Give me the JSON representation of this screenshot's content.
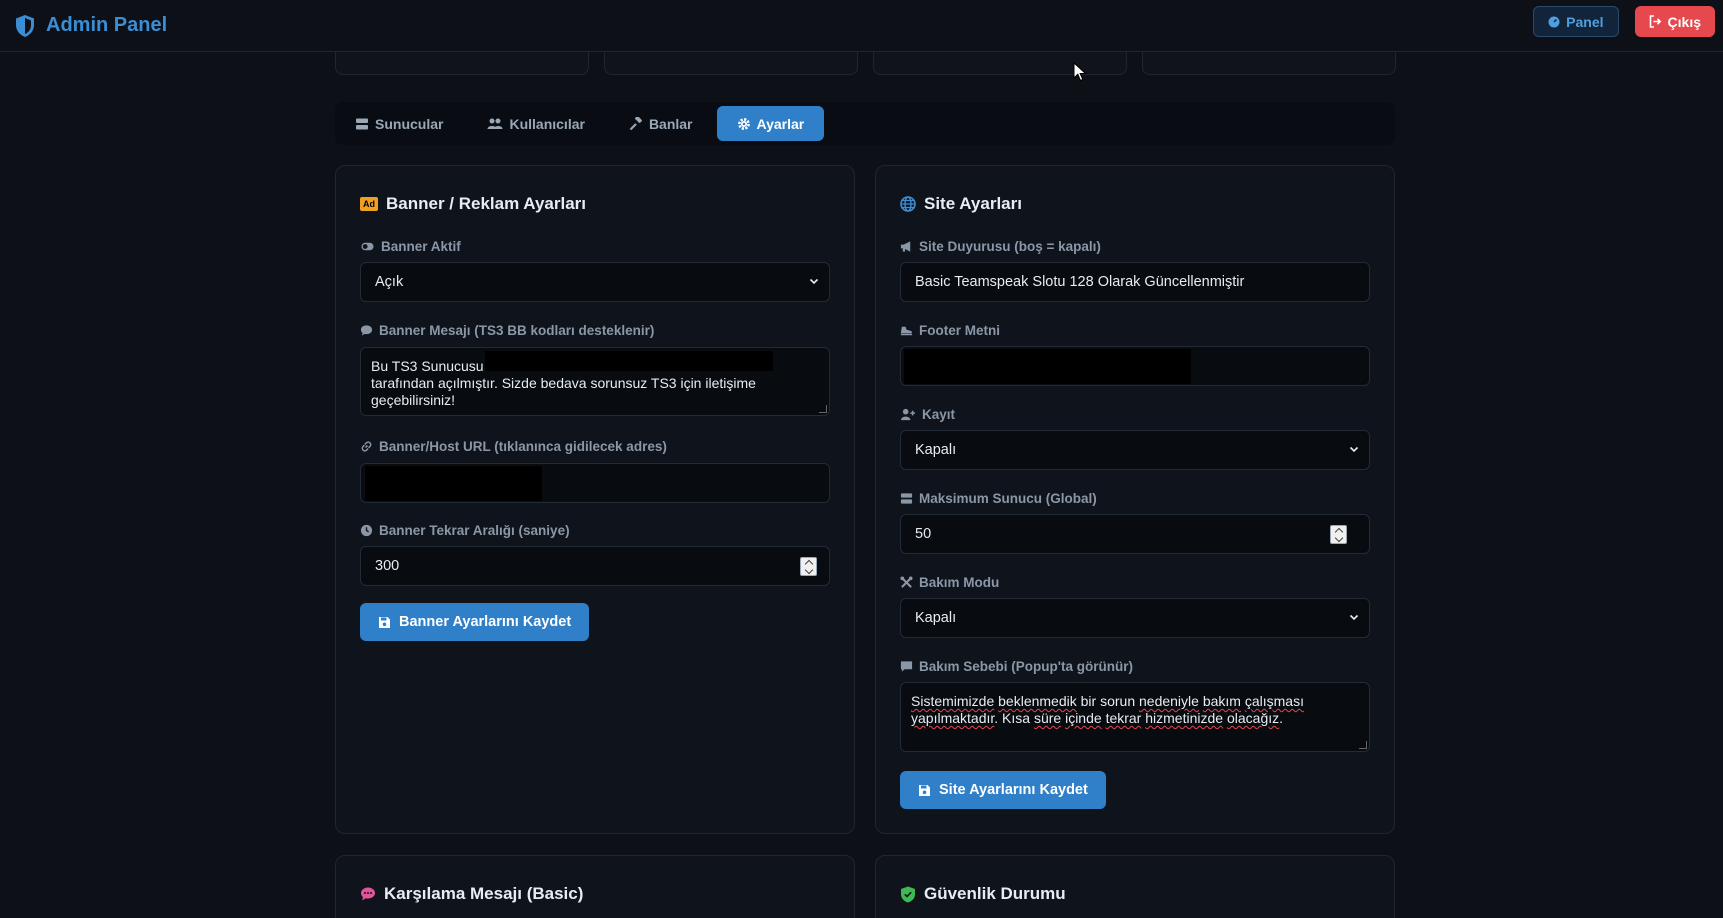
{
  "header": {
    "title": "Admin Panel",
    "panel_label": "Panel",
    "exit_label": "Çıkış"
  },
  "tabs": [
    {
      "label": "Sunucular",
      "icon": "server-icon",
      "active": false
    },
    {
      "label": "Kullanıcılar",
      "icon": "users-icon",
      "active": false
    },
    {
      "label": "Banlar",
      "icon": "gavel-icon",
      "active": false
    },
    {
      "label": "Ayarlar",
      "icon": "gear-icon",
      "active": true
    }
  ],
  "banner": {
    "title": "Banner / Reklam Ayarları",
    "badge": "Ad",
    "active_label": "Banner Aktif",
    "active_value": "Açık",
    "message_label": "Banner Mesajı (TS3 BB kodları desteklenir)",
    "message_line1": "Bu TS3 Sunucusu",
    "message_line2": "tarafından açılmıştır. Sizde bedava sorunsuz TS3 için iletişime",
    "message_line3": "geçebilirsiniz!",
    "url_label": "Banner/Host URL (tıklanınca gidilecek adres)",
    "interval_label": "Banner Tekrar Aralığı (saniye)",
    "interval_value": "300",
    "save_label": "Banner Ayarlarını Kaydet"
  },
  "site": {
    "title": "Site Ayarları",
    "announcement_label": "Site Duyurusu (boş = kapalı)",
    "announcement_value": "Basic Teamspeak Slotu 128 Olarak Güncellenmiştir",
    "footer_label": "Footer Metni",
    "register_label": "Kayıt",
    "register_value": "Kapalı",
    "max_server_label": "Maksimum Sunucu (Global)",
    "max_server_value": "50",
    "maintenance_label": "Bakım Modu",
    "maintenance_value": "Kapalı",
    "reason_label": "Bakım Sebebi (Popup'ta görünür)",
    "reason_w1": "Sistemimizde",
    "reason_w2": "beklenmedik",
    "reason_w3": "bir sorun",
    "reason_w4": "nedeniyle",
    "reason_w5": "bakım",
    "reason_w6": "çalışması",
    "reason_w7": "yapılmaktadır",
    "reason_w8": ". Kısa",
    "reason_w9": "süre",
    "reason_w10": "içinde",
    "reason_w11": "tekrar",
    "reason_w12": "hizmetinizde",
    "reason_w13": "olacağız",
    "reason_w14": ".",
    "save_label": "Site Ayarlarını Kaydet"
  },
  "welcome": {
    "title": "Karşılama Mesajı (Basic)"
  },
  "security": {
    "title": "Güvenlik Durumu"
  },
  "colors": {
    "accent": "#2f7fc9",
    "danger": "#e5484d",
    "background": "#0d1117"
  }
}
